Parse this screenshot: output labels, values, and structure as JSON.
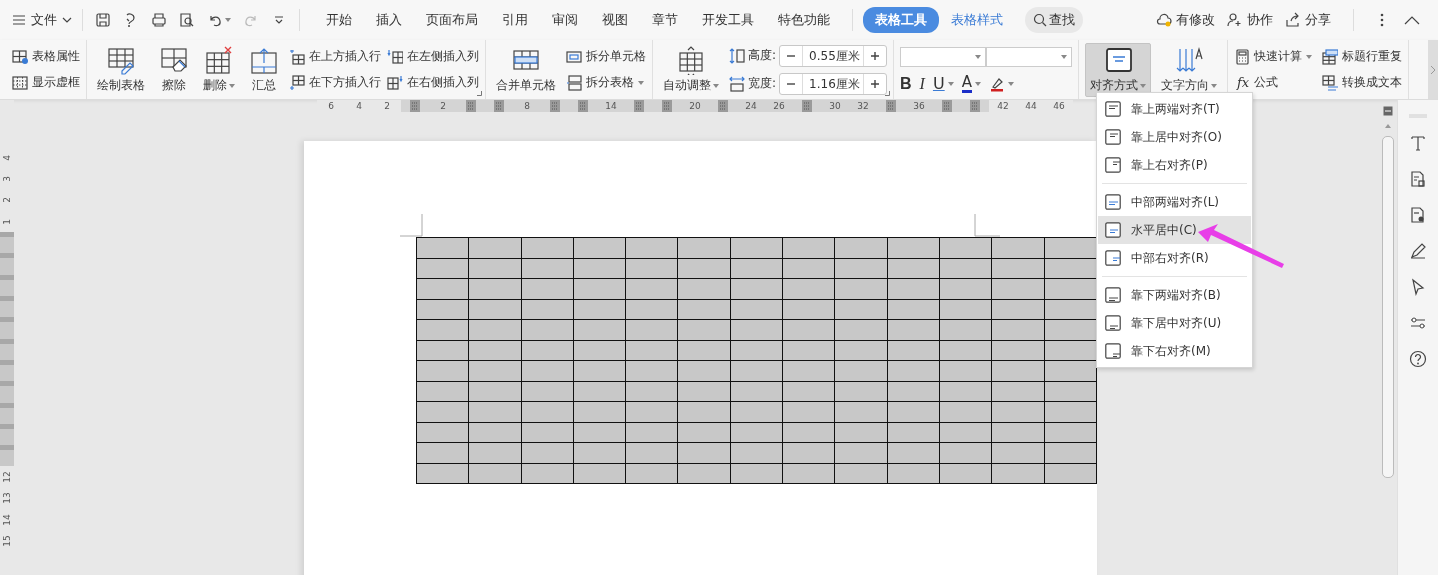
{
  "menu": {
    "label": "文件"
  },
  "tabs": [
    {
      "label": "开始",
      "selected": false,
      "kind": "main"
    },
    {
      "label": "插入",
      "selected": false,
      "kind": "main"
    },
    {
      "label": "页面布局",
      "selected": false,
      "kind": "main"
    },
    {
      "label": "引用",
      "selected": false,
      "kind": "main"
    },
    {
      "label": "审阅",
      "selected": false,
      "kind": "main"
    },
    {
      "label": "视图",
      "selected": false,
      "kind": "main"
    },
    {
      "label": "章节",
      "selected": false,
      "kind": "main"
    },
    {
      "label": "开发工具",
      "selected": false,
      "kind": "main"
    },
    {
      "label": "特色功能",
      "selected": false,
      "kind": "main"
    },
    {
      "label": "表格工具",
      "selected": true,
      "kind": "context"
    },
    {
      "label": "表格样式",
      "selected": false,
      "kind": "context"
    }
  ],
  "search": {
    "label": "查找"
  },
  "header_actions": [
    {
      "label": "有修改"
    },
    {
      "label": "协作"
    },
    {
      "label": "分享"
    }
  ],
  "ribbon": {
    "groups": [
      {
        "kind": "buttons",
        "launcher": false,
        "items": [
          {
            "kind": "small",
            "label": "表格属性",
            "dropdown": false
          },
          {
            "kind": "small",
            "label": "显示虚框",
            "dropdown": false
          }
        ]
      },
      {
        "kind": "buttons",
        "launcher": true,
        "items": [
          {
            "kind": "large",
            "label": "绘制表格",
            "dropdown": false
          },
          {
            "kind": "large",
            "label": "擦除",
            "dropdown": false
          },
          {
            "kind": "large",
            "label": "删除",
            "dropdown": true
          },
          {
            "kind": "large",
            "label": "汇总",
            "dropdown": false
          },
          {
            "kind": "small",
            "label": "在上方插入行",
            "dropdown": false
          },
          {
            "kind": "small",
            "label": "在下方插入行",
            "dropdown": false
          },
          {
            "kind": "small",
            "label": "在左侧插入列",
            "dropdown": false
          },
          {
            "kind": "small",
            "label": "在右侧插入列",
            "dropdown": false
          }
        ]
      },
      {
        "kind": "buttons",
        "launcher": false,
        "items": [
          {
            "kind": "large",
            "label": "合并单元格",
            "dropdown": false
          },
          {
            "kind": "small",
            "label": "拆分单元格",
            "dropdown": false
          },
          {
            "kind": "small",
            "label": "拆分表格",
            "dropdown": true
          }
        ]
      },
      {
        "kind": "buttons",
        "launcher": true,
        "items": [
          {
            "kind": "large",
            "label": "自动调整",
            "dropdown": true
          },
          {
            "kind": "spinner",
            "label": "高度:",
            "value": "0.55厘米"
          },
          {
            "kind": "spinner",
            "label": "宽度:",
            "value": "1.16厘米"
          }
        ]
      },
      {
        "kind": "font",
        "launcher": false,
        "items": [
          {
            "kind": "combo"
          },
          {
            "kind": "combo"
          },
          {
            "kind": "bold",
            "label": "B",
            "dropdown": false
          },
          {
            "kind": "italic",
            "label": "I",
            "dropdown": false
          },
          {
            "kind": "underline",
            "label": "U",
            "dropdown": true
          },
          {
            "kind": "font-color",
            "label": "A",
            "dropdown": true
          },
          {
            "kind": "highlight",
            "dropdown": true
          }
        ]
      },
      {
        "kind": "buttons",
        "launcher": false,
        "items": [
          {
            "kind": "large",
            "label": "对齐方式",
            "dropdown": true,
            "pressed": true
          },
          {
            "kind": "large",
            "label": "文字方向",
            "dropdown": true,
            "pressed": false
          }
        ]
      },
      {
        "kind": "grid",
        "launcher": false,
        "items": [
          {
            "kind": "small",
            "label": "快速计算",
            "dropdown": true
          },
          {
            "kind": "small",
            "label": "标题行重复",
            "dropdown": false
          },
          {
            "kind": "small",
            "label": "公式",
            "glyph": "fx",
            "dropdown": false
          },
          {
            "kind": "small",
            "label": "转换成文本",
            "dropdown": false
          }
        ]
      }
    ]
  },
  "ruler": {
    "ticks": [
      {
        "label": "6",
        "marker": false
      },
      {
        "label": "4",
        "marker": false
      },
      {
        "label": "2",
        "marker": false
      },
      {
        "marker": true
      },
      {
        "label": "2",
        "marker": false
      },
      {
        "marker": true
      },
      {
        "marker": true
      },
      {
        "label": "8",
        "marker": false
      },
      {
        "marker": true
      },
      {
        "marker": true
      },
      {
        "label": "14",
        "marker": false
      },
      {
        "marker": true
      },
      {
        "marker": true
      },
      {
        "label": "20",
        "marker": false
      },
      {
        "marker": true
      },
      {
        "label": "24",
        "marker": false
      },
      {
        "label": "26",
        "marker": false
      },
      {
        "marker": true
      },
      {
        "label": "30",
        "marker": false
      },
      {
        "label": "32",
        "marker": false
      },
      {
        "marker": true
      },
      {
        "label": "36",
        "marker": false
      },
      {
        "marker": true
      },
      {
        "marker": true
      },
      {
        "label": "42",
        "marker": false
      },
      {
        "label": "44",
        "marker": false
      },
      {
        "label": "46",
        "marker": false
      }
    ]
  },
  "vertical_ruler": {
    "ticks": [
      {
        "label": "4",
        "marker": false
      },
      {
        "label": "3",
        "marker": false
      },
      {
        "label": "2",
        "marker": false
      },
      {
        "label": "1",
        "marker": false
      },
      {
        "marker": true
      },
      {
        "marker": true
      },
      {
        "marker": true
      },
      {
        "marker": true
      },
      {
        "marker": true
      },
      {
        "marker": true
      },
      {
        "marker": true
      },
      {
        "marker": true
      },
      {
        "marker": true
      },
      {
        "marker": true
      },
      {
        "marker": true
      },
      {
        "label": "12",
        "marker": false
      },
      {
        "label": "13",
        "marker": false
      },
      {
        "label": "14",
        "marker": false
      },
      {
        "label": "15",
        "marker": false
      }
    ]
  },
  "table": {
    "rows": [
      {
        "cells": [
          {
            "selected": true
          },
          {
            "selected": true
          },
          {
            "selected": true
          },
          {
            "selected": true
          },
          {
            "selected": true
          },
          {
            "selected": true
          },
          {
            "selected": true
          },
          {
            "selected": true
          },
          {
            "selected": true
          },
          {
            "selected": true
          },
          {
            "selected": true
          },
          {
            "selected": true
          },
          {
            "selected": true
          }
        ]
      },
      {
        "cells": [
          {
            "selected": true
          },
          {
            "selected": true
          },
          {
            "selected": true
          },
          {
            "selected": true
          },
          {
            "selected": true
          },
          {
            "selected": true
          },
          {
            "selected": true
          },
          {
            "selected": true
          },
          {
            "selected": true
          },
          {
            "selected": true
          },
          {
            "selected": true
          },
          {
            "selected": true
          },
          {
            "selected": true
          }
        ]
      },
      {
        "cells": [
          {
            "selected": true
          },
          {
            "selected": true
          },
          {
            "selected": true
          },
          {
            "selected": true
          },
          {
            "selected": true
          },
          {
            "selected": true
          },
          {
            "selected": true
          },
          {
            "selected": true
          },
          {
            "selected": true
          },
          {
            "selected": true
          },
          {
            "selected": true
          },
          {
            "selected": true
          },
          {
            "selected": true
          }
        ]
      },
      {
        "cells": [
          {
            "selected": true
          },
          {
            "selected": true
          },
          {
            "selected": true
          },
          {
            "selected": true
          },
          {
            "selected": true
          },
          {
            "selected": true
          },
          {
            "selected": true
          },
          {
            "selected": true
          },
          {
            "selected": true
          },
          {
            "selected": true
          },
          {
            "selected": true
          },
          {
            "selected": true
          },
          {
            "selected": true
          }
        ]
      },
      {
        "cells": [
          {
            "selected": true
          },
          {
            "selected": true
          },
          {
            "selected": true
          },
          {
            "selected": true
          },
          {
            "selected": true
          },
          {
            "selected": true
          },
          {
            "selected": true
          },
          {
            "selected": true
          },
          {
            "selected": true
          },
          {
            "selected": true
          },
          {
            "selected": true
          },
          {
            "selected": true
          },
          {
            "selected": true
          }
        ]
      },
      {
        "cells": [
          {
            "selected": true
          },
          {
            "selected": true
          },
          {
            "selected": true
          },
          {
            "selected": true
          },
          {
            "selected": true
          },
          {
            "selected": true
          },
          {
            "selected": true
          },
          {
            "selected": true
          },
          {
            "selected": true
          },
          {
            "selected": true
          },
          {
            "selected": true
          },
          {
            "selected": true
          },
          {
            "selected": true
          }
        ]
      },
      {
        "cells": [
          {
            "selected": true
          },
          {
            "selected": true
          },
          {
            "selected": true
          },
          {
            "selected": true
          },
          {
            "selected": true
          },
          {
            "selected": true
          },
          {
            "selected": true
          },
          {
            "selected": true
          },
          {
            "selected": true
          },
          {
            "selected": true
          },
          {
            "selected": true
          },
          {
            "selected": true
          },
          {
            "selected": true
          }
        ]
      },
      {
        "cells": [
          {
            "selected": true
          },
          {
            "selected": true
          },
          {
            "selected": true
          },
          {
            "selected": true
          },
          {
            "selected": true
          },
          {
            "selected": true
          },
          {
            "selected": true
          },
          {
            "selected": true
          },
          {
            "selected": true
          },
          {
            "selected": true
          },
          {
            "selected": true
          },
          {
            "selected": true
          },
          {
            "selected": true
          }
        ]
      },
      {
        "cells": [
          {
            "selected": true
          },
          {
            "selected": true
          },
          {
            "selected": true
          },
          {
            "selected": true
          },
          {
            "selected": true
          },
          {
            "selected": true
          },
          {
            "selected": true
          },
          {
            "selected": true
          },
          {
            "selected": true
          },
          {
            "selected": true
          },
          {
            "selected": true
          },
          {
            "selected": true
          },
          {
            "selected": true
          }
        ]
      },
      {
        "cells": [
          {
            "selected": true
          },
          {
            "selected": true
          },
          {
            "selected": true
          },
          {
            "selected": true
          },
          {
            "selected": true
          },
          {
            "selected": true
          },
          {
            "selected": true
          },
          {
            "selected": true
          },
          {
            "selected": true
          },
          {
            "selected": true
          },
          {
            "selected": true
          },
          {
            "selected": true
          },
          {
            "selected": true
          }
        ]
      },
      {
        "cells": [
          {
            "selected": true
          },
          {
            "selected": true
          },
          {
            "selected": true
          },
          {
            "selected": true
          },
          {
            "selected": true
          },
          {
            "selected": true
          },
          {
            "selected": true
          },
          {
            "selected": true
          },
          {
            "selected": true
          },
          {
            "selected": true
          },
          {
            "selected": true
          },
          {
            "selected": true
          },
          {
            "selected": true
          }
        ]
      },
      {
        "cells": [
          {
            "selected": true
          },
          {
            "selected": true
          },
          {
            "selected": true
          },
          {
            "selected": true
          },
          {
            "selected": true
          },
          {
            "selected": true
          },
          {
            "selected": true
          },
          {
            "selected": true
          },
          {
            "selected": true
          },
          {
            "selected": true
          },
          {
            "selected": true
          },
          {
            "selected": true
          },
          {
            "selected": true
          }
        ]
      }
    ]
  },
  "align_menu": {
    "sections": [
      {
        "items": [
          {
            "label": "靠上两端对齐(T)",
            "selected": false
          },
          {
            "label": "靠上居中对齐(O)",
            "selected": false
          },
          {
            "label": "靠上右对齐(P)",
            "selected": false
          }
        ]
      },
      {
        "items": [
          {
            "label": "中部两端对齐(L)",
            "selected": false
          },
          {
            "label": "水平居中(C)",
            "selected": true
          },
          {
            "label": "中部右对齐(R)",
            "selected": false
          }
        ]
      },
      {
        "items": [
          {
            "label": "靠下两端对齐(B)",
            "selected": false
          },
          {
            "label": "靠下居中对齐(U)",
            "selected": false
          },
          {
            "label": "靠下右对齐(M)",
            "selected": false
          }
        ]
      }
    ]
  }
}
